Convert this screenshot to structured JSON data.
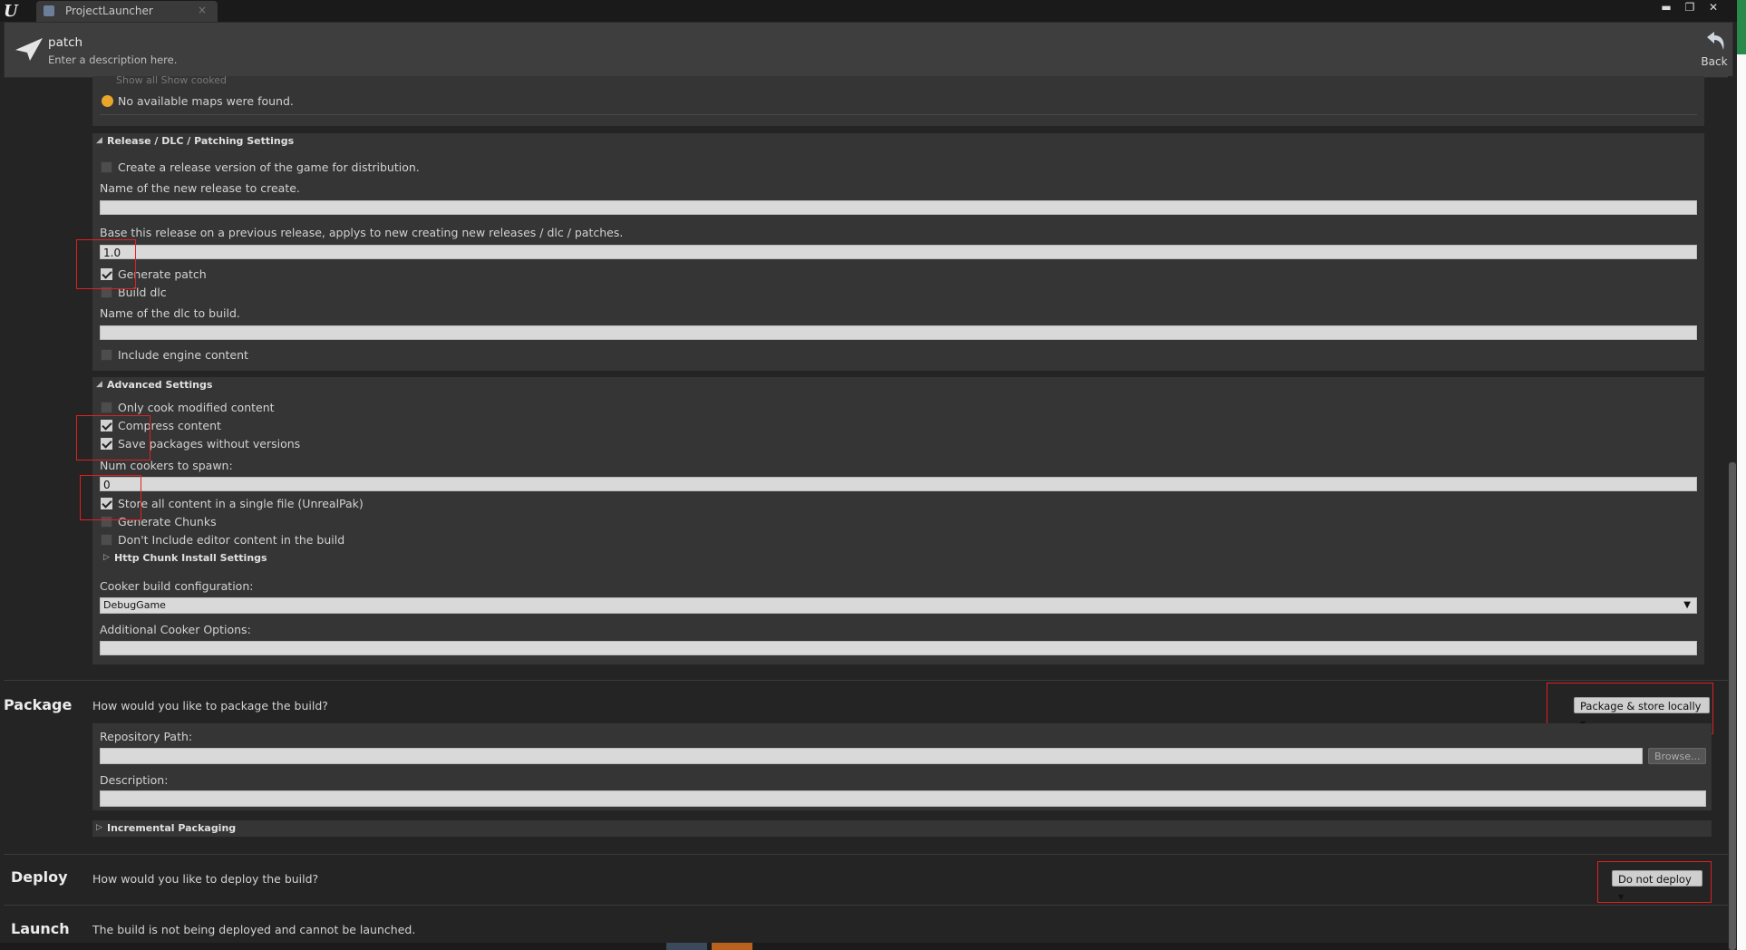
{
  "window": {
    "tab_label": "ProjectLauncher",
    "tab_close": "×",
    "minimize": "▬",
    "restore": "❐",
    "close": "✕"
  },
  "header": {
    "title": "patch",
    "description": "Enter a description here.",
    "back_label": "Back"
  },
  "maps": {
    "partial_options": "Show all      Show cooked",
    "warning": "No available maps were found."
  },
  "release_settings": {
    "title": "Release / DLC / Patching Settings",
    "create_release_label": "Create a release version of the game for distribution.",
    "create_release_checked": false,
    "new_release_name_label": "Name of the new release to create.",
    "new_release_name_value": "",
    "base_release_label": "Base this release on a previous release, applys to new creating new releases / dlc / patches.",
    "base_release_value": "1.0",
    "generate_patch_label": "Generate patch",
    "generate_patch_checked": true,
    "build_dlc_label": "Build dlc",
    "build_dlc_checked": false,
    "dlc_name_label": "Name of the dlc to build.",
    "dlc_name_value": "",
    "include_engine_label": "Include engine content",
    "include_engine_checked": false
  },
  "advanced_settings": {
    "title": "Advanced Settings",
    "only_cook_modified_label": "Only cook modified content",
    "compress_content_label": "Compress content",
    "save_packages_label": "Save packages without versions",
    "num_cookers_label": "Num cookers to spawn:",
    "num_cookers_value": "0",
    "single_file_label": "Store all content in a single file (UnrealPak)",
    "generate_chunks_label": "Generate Chunks",
    "no_editor_content_label": "Don't Include editor content in the build",
    "http_chunk_label": "Http Chunk Install Settings",
    "cooker_build_config_label": "Cooker build configuration:",
    "cooker_build_config_value": "DebugGame",
    "additional_cooker_label": "Additional Cooker Options:",
    "additional_cooker_value": ""
  },
  "package": {
    "title": "Package",
    "question": "How would you like to package the build?",
    "dropdown_value": "Package & store locally",
    "repository_label": "Repository Path:",
    "repository_value": "",
    "browse_label": "Browse...",
    "description_label": "Description:",
    "description_value": "",
    "incremental_label": "Incremental Packaging"
  },
  "deploy": {
    "title": "Deploy",
    "question": "How would you like to deploy the build?",
    "dropdown_value": "Do not deploy"
  },
  "launch": {
    "title": "Launch",
    "message": "The build is not being deployed and cannot be launched."
  }
}
